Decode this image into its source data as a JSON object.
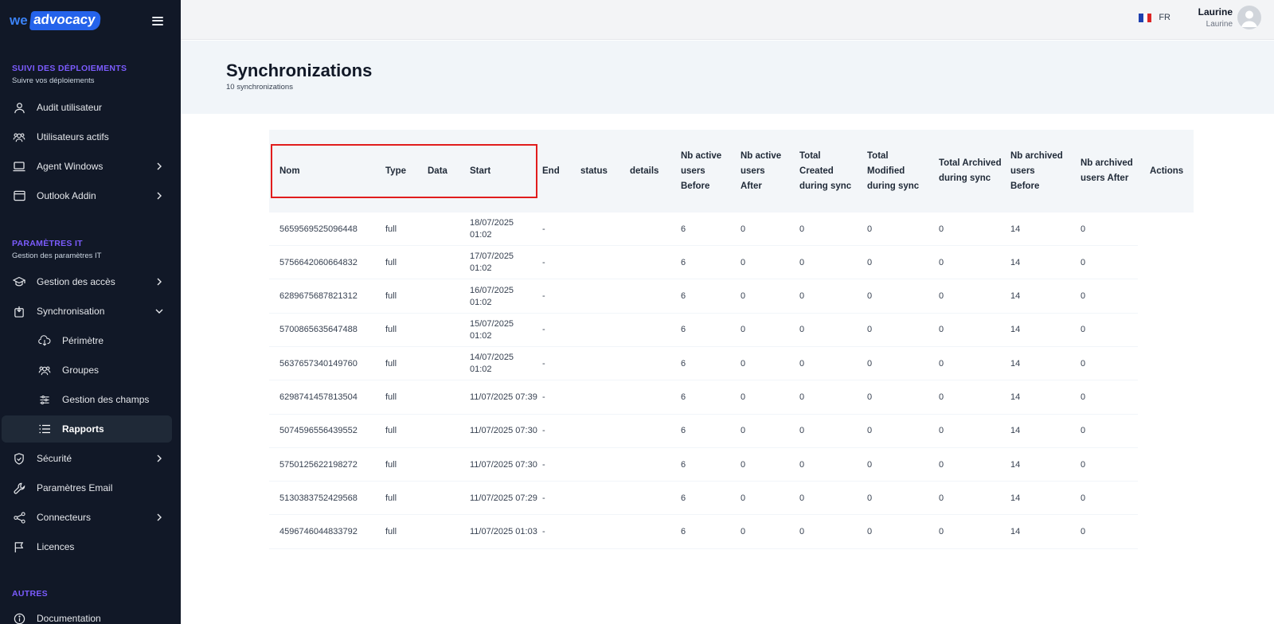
{
  "sidebar": {
    "logo": {
      "we": "we",
      "advocacy": "advocacy"
    },
    "sections": [
      {
        "title": "SUIVI DES DÉPLOIEMENTS",
        "subtitle": "Suivre vos déploiements"
      },
      {
        "title": "PARAMÈTRES IT",
        "subtitle": "Gestion des paramètres IT"
      },
      {
        "title": "AUTRES"
      }
    ],
    "items": {
      "audit": {
        "label": "Audit utilisateur",
        "icon": "user-icon"
      },
      "actifs": {
        "label": "Utilisateurs actifs",
        "icon": "users-icon"
      },
      "agent": {
        "label": "Agent Windows",
        "icon": "laptop-icon"
      },
      "outlook": {
        "label": "Outlook Addin",
        "icon": "browser-window-icon"
      },
      "acces": {
        "label": "Gestion des accès",
        "icon": "graduation-cap-icon"
      },
      "sync": {
        "label": "Synchronisation",
        "icon": "sync-box-icon"
      },
      "perimetre": {
        "label": "Périmètre",
        "icon": "cloud-download-icon"
      },
      "groupes": {
        "label": "Groupes",
        "icon": "users-icon"
      },
      "champs": {
        "label": "Gestion des champs",
        "icon": "sliders-icon"
      },
      "rapports": {
        "label": "Rapports",
        "icon": "list-icon"
      },
      "securite": {
        "label": "Sécurité",
        "icon": "shield-check-icon"
      },
      "email": {
        "label": "Paramètres Email",
        "icon": "wrench-icon"
      },
      "connecteurs": {
        "label": "Connecteurs",
        "icon": "share-nodes-icon"
      },
      "licences": {
        "label": "Licences",
        "icon": "flag-icon"
      },
      "documentation": {
        "label": "Documentation",
        "icon": "info-icon"
      }
    }
  },
  "topbar": {
    "lang": "FR",
    "user_name": "Laurine",
    "user_sub": "Laurine"
  },
  "page": {
    "title": "Synchronizations",
    "subtitle": "10 synchronizations"
  },
  "table": {
    "headers": {
      "nom": "Nom",
      "type": "Type",
      "data": "Data",
      "start": "Start",
      "end": "End",
      "status": "status",
      "details": "details",
      "nb_active_before": "Nb active users Before",
      "nb_active_after": "Nb active users After",
      "total_created": "Total Created during sync",
      "total_modified": "Total Modified during sync",
      "total_archived": "Total Archived during sync",
      "nb_archived_before": "Nb archived users Before",
      "nb_archived_after": "Nb archived users After",
      "actions": "Actions"
    },
    "rows": [
      {
        "nom": "5659569525096448",
        "type": "full",
        "data": "",
        "start": "18/07/2025 01:02",
        "end": "-",
        "status": "",
        "details": "",
        "nb_active_before": "6",
        "nb_active_after": "0",
        "total_created": "0",
        "total_modified": "0",
        "total_archived": "0",
        "nb_archived_before": "14",
        "nb_archived_after": "0"
      },
      {
        "nom": "5756642060664832",
        "type": "full",
        "data": "",
        "start": "17/07/2025 01:02",
        "end": "-",
        "status": "",
        "details": "",
        "nb_active_before": "6",
        "nb_active_after": "0",
        "total_created": "0",
        "total_modified": "0",
        "total_archived": "0",
        "nb_archived_before": "14",
        "nb_archived_after": "0"
      },
      {
        "nom": "6289675687821312",
        "type": "full",
        "data": "",
        "start": "16/07/2025 01:02",
        "end": "-",
        "status": "",
        "details": "",
        "nb_active_before": "6",
        "nb_active_after": "0",
        "total_created": "0",
        "total_modified": "0",
        "total_archived": "0",
        "nb_archived_before": "14",
        "nb_archived_after": "0"
      },
      {
        "nom": "5700865635647488",
        "type": "full",
        "data": "",
        "start": "15/07/2025 01:02",
        "end": "-",
        "status": "",
        "details": "",
        "nb_active_before": "6",
        "nb_active_after": "0",
        "total_created": "0",
        "total_modified": "0",
        "total_archived": "0",
        "nb_archived_before": "14",
        "nb_archived_after": "0"
      },
      {
        "nom": "5637657340149760",
        "type": "full",
        "data": "",
        "start": "14/07/2025 01:02",
        "end": "-",
        "status": "",
        "details": "",
        "nb_active_before": "6",
        "nb_active_after": "0",
        "total_created": "0",
        "total_modified": "0",
        "total_archived": "0",
        "nb_archived_before": "14",
        "nb_archived_after": "0"
      },
      {
        "nom": "6298741457813504",
        "type": "full",
        "data": "",
        "start": "11/07/2025 07:39",
        "end": "-",
        "status": "",
        "details": "",
        "nb_active_before": "6",
        "nb_active_after": "0",
        "total_created": "0",
        "total_modified": "0",
        "total_archived": "0",
        "nb_archived_before": "14",
        "nb_archived_after": "0"
      },
      {
        "nom": "5074596556439552",
        "type": "full",
        "data": "",
        "start": "11/07/2025 07:30",
        "end": "-",
        "status": "",
        "details": "",
        "nb_active_before": "6",
        "nb_active_after": "0",
        "total_created": "0",
        "total_modified": "0",
        "total_archived": "0",
        "nb_archived_before": "14",
        "nb_archived_after": "0"
      },
      {
        "nom": "5750125622198272",
        "type": "full",
        "data": "",
        "start": "11/07/2025 07:30",
        "end": "-",
        "status": "",
        "details": "",
        "nb_active_before": "6",
        "nb_active_after": "0",
        "total_created": "0",
        "total_modified": "0",
        "total_archived": "0",
        "nb_archived_before": "14",
        "nb_archived_after": "0"
      },
      {
        "nom": "5130383752429568",
        "type": "full",
        "data": "",
        "start": "11/07/2025 07:29",
        "end": "-",
        "status": "",
        "details": "",
        "nb_active_before": "6",
        "nb_active_after": "0",
        "total_created": "0",
        "total_modified": "0",
        "total_archived": "0",
        "nb_archived_before": "14",
        "nb_archived_after": "0"
      },
      {
        "nom": "4596746044833792",
        "type": "full",
        "data": "",
        "start": "11/07/2025 01:03",
        "end": "-",
        "status": "",
        "details": "",
        "nb_active_before": "6",
        "nb_active_after": "0",
        "total_created": "0",
        "total_modified": "0",
        "total_archived": "0",
        "nb_archived_before": "14",
        "nb_archived_after": "0"
      }
    ]
  },
  "colors": {
    "sidebar_bg": "#111827",
    "section_title": "#7c5cff",
    "brand_blue": "#2563eb",
    "highlight_border": "#e11d1d"
  }
}
